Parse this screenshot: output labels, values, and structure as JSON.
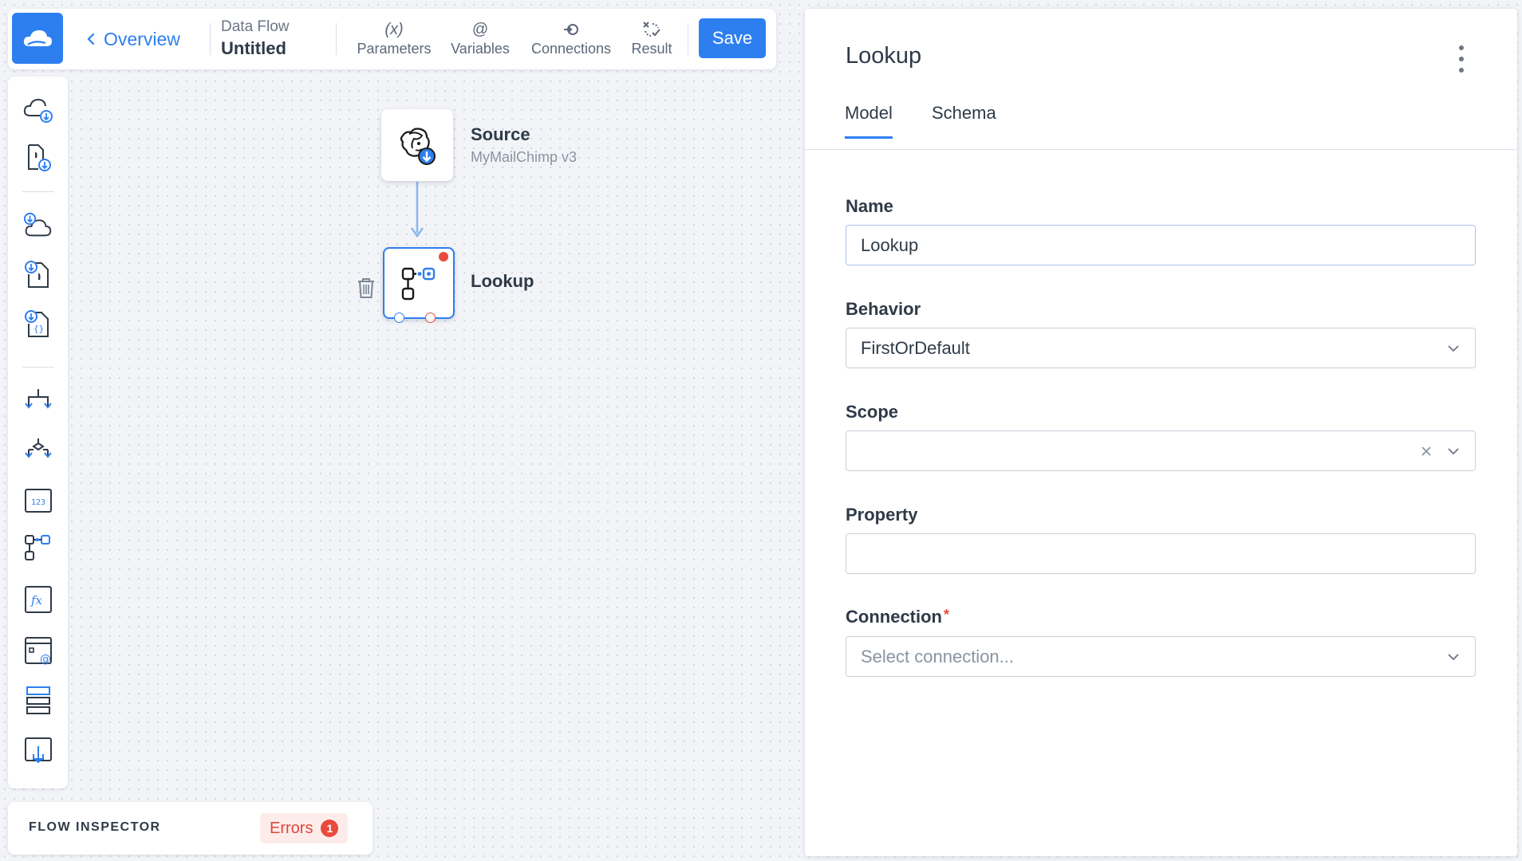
{
  "toolbar": {
    "back_label": "Overview",
    "breadcrumb_type": "Data Flow",
    "breadcrumb_name": "Untitled",
    "tools": [
      {
        "label": "Parameters",
        "icon": "(x)"
      },
      {
        "label": "Variables",
        "icon": "@"
      },
      {
        "label": "Connections",
        "icon": "connections-icon"
      },
      {
        "label": "Result",
        "icon": "result-icon"
      }
    ],
    "save_label": "Save"
  },
  "palette": {
    "items": [
      "cloud-source-icon",
      "file-source-icon",
      "cloud-target-icon",
      "csv-target-icon",
      "json-target-icon",
      "split-icon",
      "merge-icon",
      "row-count-icon",
      "lookup-icon",
      "expression-icon",
      "variable-icon",
      "buffer-icon",
      "import-icon"
    ]
  },
  "inspector": {
    "title": "FLOW INSPECTOR",
    "errors_label": "Errors",
    "errors_count": "1"
  },
  "canvas": {
    "nodes": [
      {
        "label": "Source",
        "sub": "MyMailChimp v3",
        "icon": "mailchimp-icon"
      },
      {
        "label": "Lookup",
        "icon": "lookup-icon"
      }
    ]
  },
  "panel": {
    "title": "Lookup",
    "tabs": [
      "Model",
      "Schema"
    ],
    "fields": {
      "name": {
        "label": "Name",
        "value": "Lookup"
      },
      "behavior": {
        "label": "Behavior",
        "value": "FirstOrDefault"
      },
      "scope": {
        "label": "Scope",
        "value": ""
      },
      "property": {
        "label": "Property",
        "value": ""
      },
      "connection": {
        "label": "Connection",
        "required": "*",
        "placeholder": "Select connection..."
      }
    }
  },
  "colors": {
    "accent": "#2d7ff0",
    "error": "#e84a3c",
    "text": "#2f3a48"
  }
}
